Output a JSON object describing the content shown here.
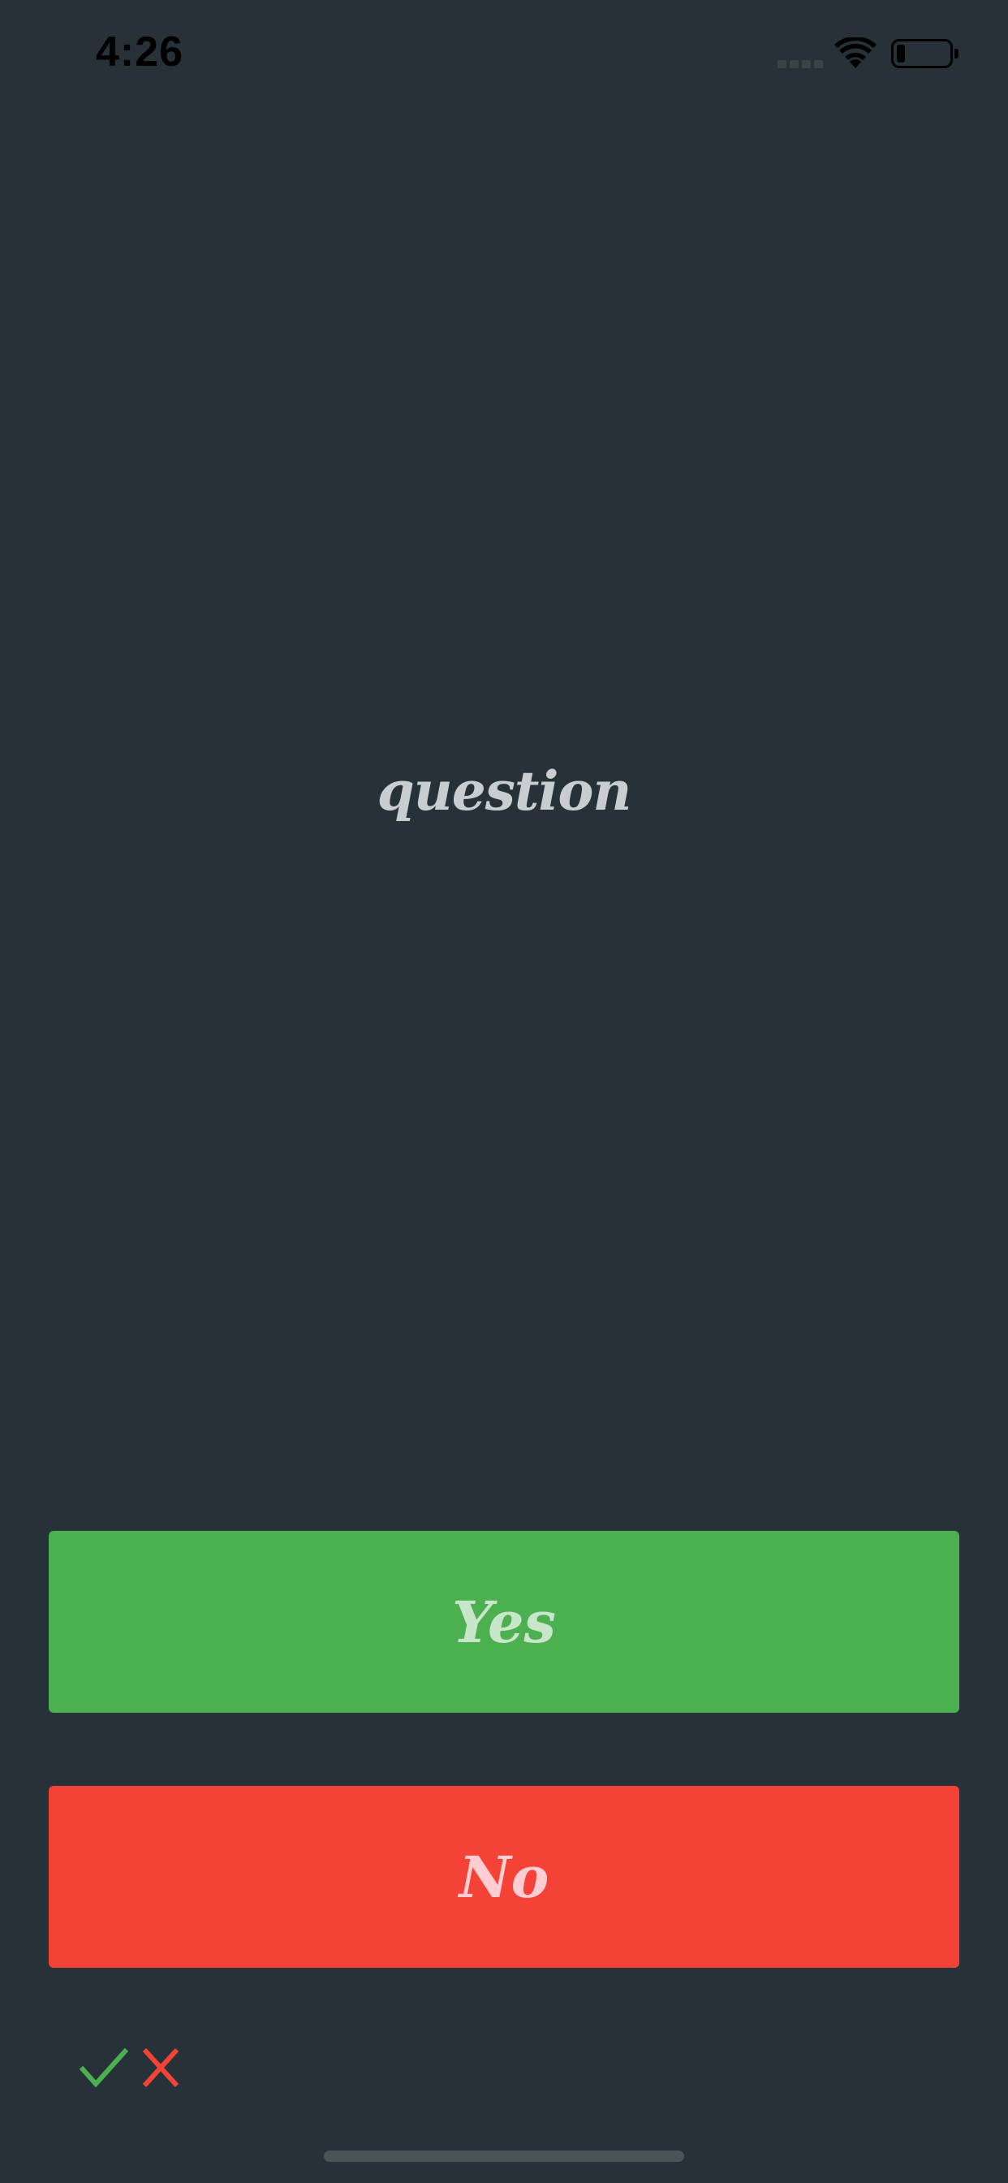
{
  "status_bar": {
    "time": "4:26",
    "icons": [
      "signal-icon",
      "wifi-icon",
      "battery-icon"
    ]
  },
  "quiz": {
    "question": "question",
    "yes_label": "Yes",
    "no_label": "No"
  },
  "score": {
    "icons": [
      "check-icon",
      "cross-icon"
    ],
    "check_color": "#4caf50",
    "cross_color": "#f44336"
  },
  "colors": {
    "background": "#263238",
    "yes_button": "#4caf50",
    "no_button": "#f44336"
  }
}
